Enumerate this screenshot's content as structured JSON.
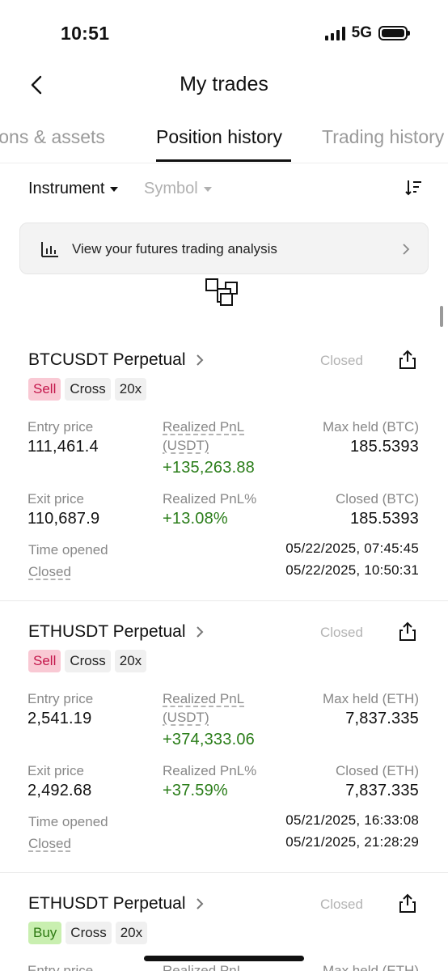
{
  "status_bar": {
    "time": "10:51",
    "network": "5G"
  },
  "header": {
    "title": "My trades"
  },
  "tabs": [
    {
      "label": "Positions & assets"
    },
    {
      "label": "Position history"
    },
    {
      "label": "Trading history"
    }
  ],
  "filters": {
    "instrument": "Instrument",
    "symbol": "Symbol"
  },
  "banner": {
    "text": "View your futures trading analysis"
  },
  "labels": {
    "entry_price": "Entry price",
    "realized_pnl": "Realized PnL",
    "realized_pnl_unit": "(USDT)",
    "realized_pnl_pct": "Realized PnL%",
    "exit_price": "Exit price",
    "time_opened": "Time opened",
    "closed": "Closed"
  },
  "positions": [
    {
      "title": "BTCUSDT Perpetual",
      "status": "Closed",
      "side": "Sell",
      "margin_mode": "Cross",
      "leverage": "20x",
      "entry_price": "111,461.4",
      "realized_pnl": "+135,263.88",
      "max_held_label": "Max held (BTC)",
      "max_held": "185.5393",
      "exit_price": "110,687.9",
      "realized_pnl_pct": "+13.08%",
      "closed_label": "Closed (BTC)",
      "closed_amount": "185.5393",
      "time_opened": "05/22/2025, 07:45:45",
      "time_closed": "05/22/2025, 10:50:31"
    },
    {
      "title": "ETHUSDT Perpetual",
      "status": "Closed",
      "side": "Sell",
      "margin_mode": "Cross",
      "leverage": "20x",
      "entry_price": "2,541.19",
      "realized_pnl": "+374,333.06",
      "max_held_label": "Max held (ETH)",
      "max_held": "7,837.335",
      "exit_price": "2,492.68",
      "realized_pnl_pct": "+37.59%",
      "closed_label": "Closed (ETH)",
      "closed_amount": "7,837.335",
      "time_opened": "05/21/2025, 16:33:08",
      "time_closed": "05/21/2025, 21:28:29"
    },
    {
      "title": "ETHUSDT Perpetual",
      "status": "Closed",
      "side": "Buy",
      "margin_mode": "Cross",
      "leverage": "20x",
      "entry_price_label": "Entry price",
      "realized_pnl_label": "Realized PnL",
      "max_held_label": "Max held (ETH)"
    }
  ],
  "colors": {
    "sell": "#c4174b",
    "buy": "#2e7a13",
    "profit": "#2a7d19"
  }
}
